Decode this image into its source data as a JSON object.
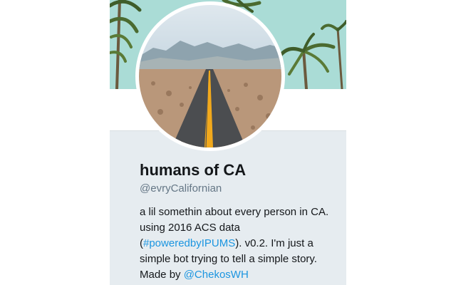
{
  "profile": {
    "display_name": "humans of CA",
    "handle": "@evryCalifornian",
    "bio": {
      "line1": "a lil somethin about every person in CA.",
      "line2": "using 2016 ACS data",
      "line3_open": "(",
      "hashtag": "#poweredbyIPUMS",
      "line3_rest": "). v0.2. I'm just a",
      "line4": "simple bot trying to tell a simple story.",
      "line5_prefix": "Made by ",
      "mention": "@ChekosWH"
    }
  },
  "colors": {
    "link": "#1b95e0",
    "info_background": "#e6ecf0",
    "banner_sky": "#aadcd6"
  }
}
